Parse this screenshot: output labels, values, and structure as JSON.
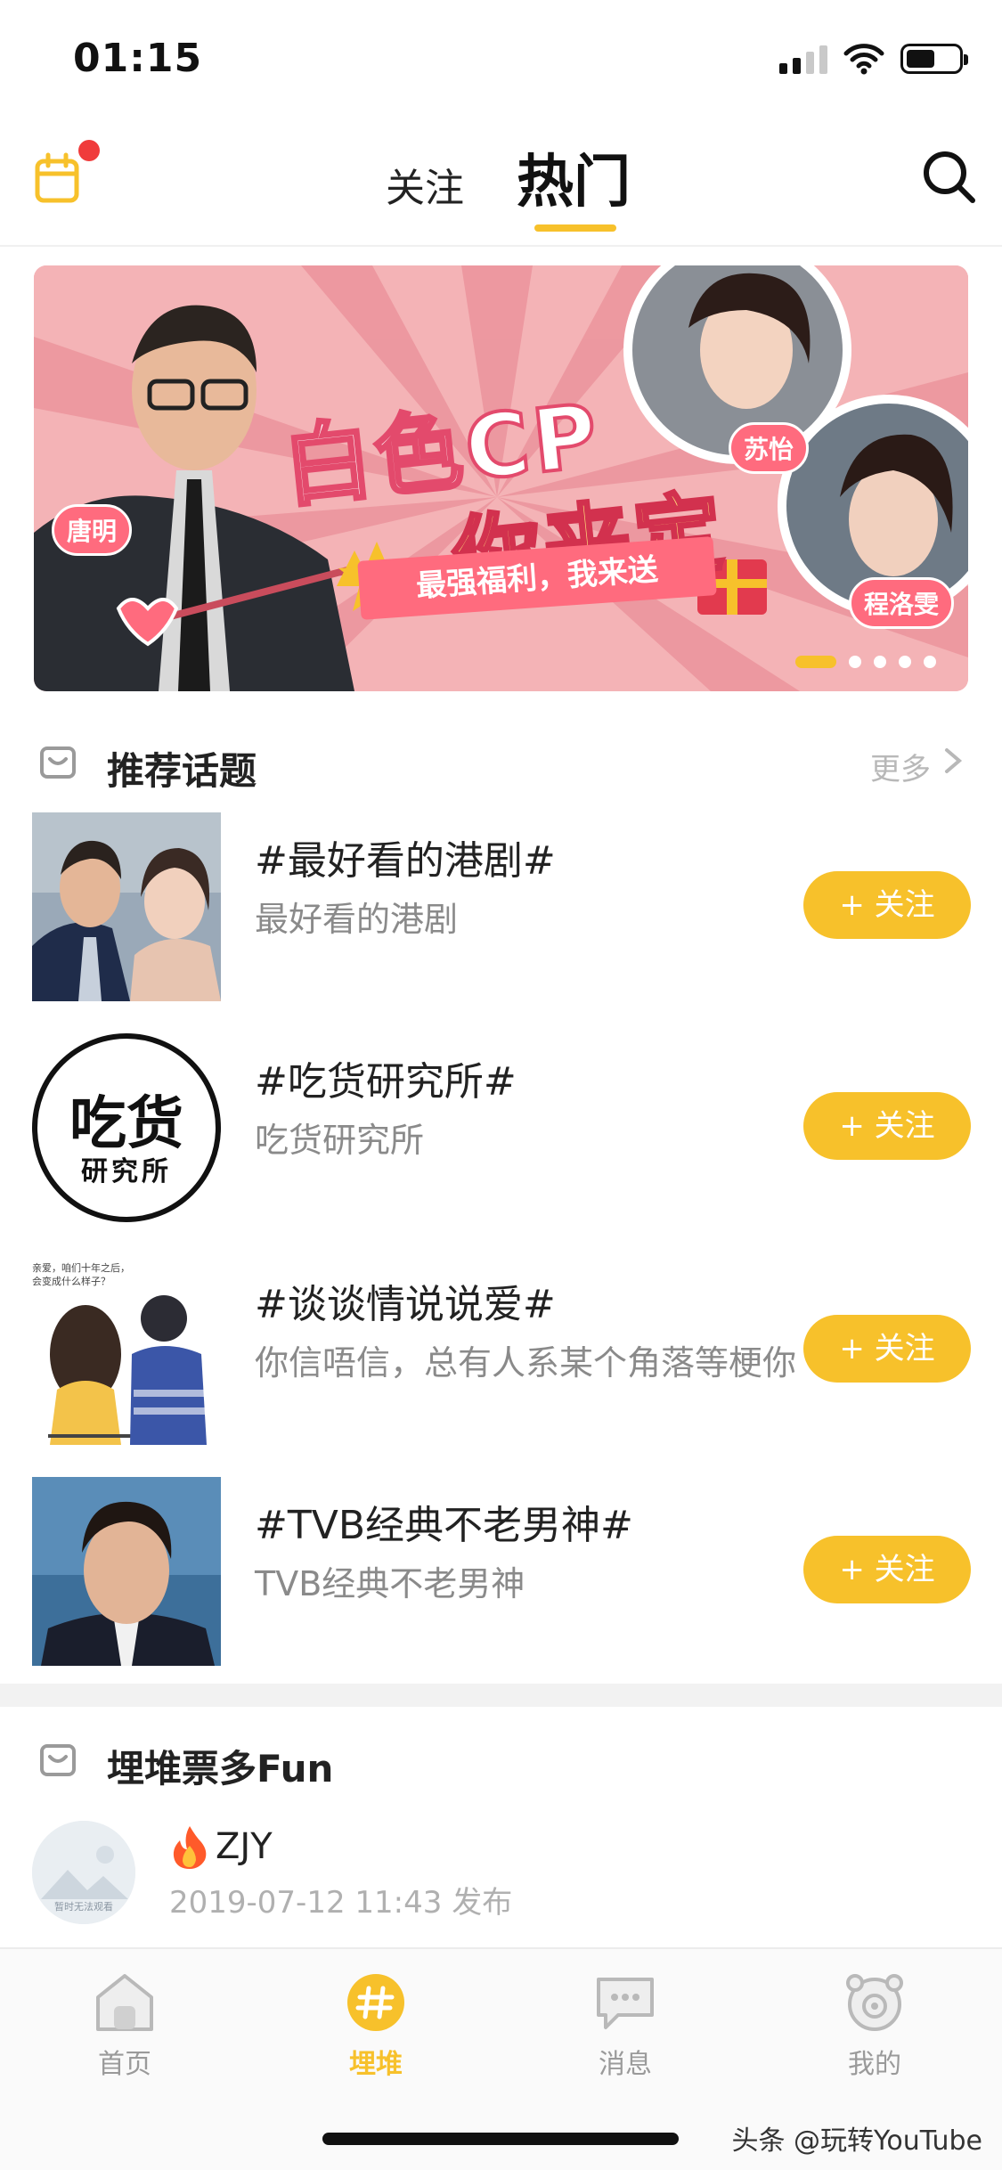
{
  "status_bar": {
    "time": "01:15"
  },
  "header": {
    "tabs": [
      {
        "label": "关注"
      },
      {
        "label": "热门"
      }
    ],
    "accent": "#f7c12b",
    "notification_dot_color": "#f03b3b"
  },
  "banner": {
    "title_line1": "白色CP",
    "title_line2": "你来定",
    "ribbon": "最强福利，我来送",
    "names": [
      "唐明",
      "苏怡",
      "程洛雯"
    ],
    "pages": 5,
    "active_page": 1
  },
  "topics_section": {
    "title": "推荐话题",
    "more": "更多",
    "items": [
      {
        "title": "#最好看的港剧#",
        "desc": "最好看的港剧",
        "button": "+ 关注"
      },
      {
        "title": "#吃货研究所#",
        "desc": "吃货研究所",
        "button": "+ 关注",
        "logo_text_top": "吃货",
        "logo_text_bottom": "研究所"
      },
      {
        "title": "#谈谈情说说爱#",
        "desc": "你信唔信，总有人系某个角落等梗你",
        "button": "+ 关注",
        "caption": "亲爱，咱们十年之后，会变成什么样子？"
      },
      {
        "title": "#TVB经典不老男神#",
        "desc": "TVB经典不老男神",
        "button": "+ 关注"
      }
    ]
  },
  "post_section": {
    "title": "埋堆票多Fun",
    "post": {
      "user": "ZJY",
      "time": "2019-07-12 11:43 发布",
      "avatar_caption": "暂时无法观看"
    }
  },
  "tabbar": {
    "items": [
      {
        "label": "首页",
        "icon": "home-icon"
      },
      {
        "label": "埋堆",
        "icon": "hashtag-icon"
      },
      {
        "label": "消息",
        "icon": "message-icon"
      },
      {
        "label": "我的",
        "icon": "profile-icon"
      }
    ],
    "active": "埋堆"
  },
  "watermark": "头条 @玩转YouTube"
}
